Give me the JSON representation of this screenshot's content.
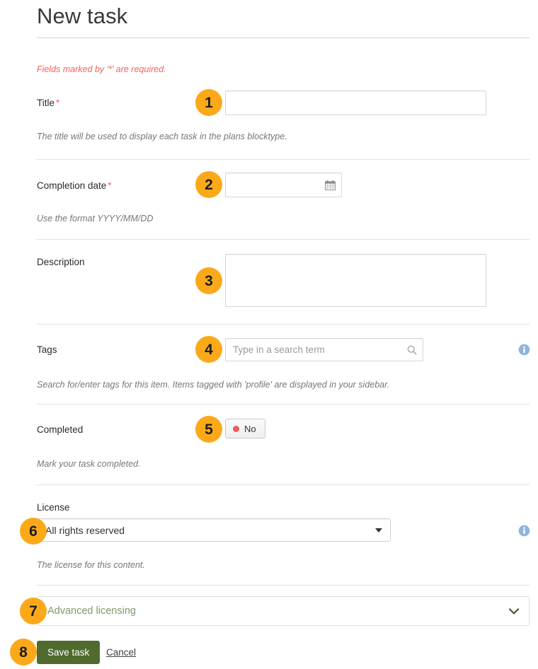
{
  "page": {
    "title": "New task",
    "required_note": "Fields marked by '*' are required."
  },
  "fields": {
    "title": {
      "label": "Title",
      "required_mark": "*",
      "value": "",
      "help": "The title will be used to display each task in the plans blocktype."
    },
    "completion_date": {
      "label": "Completion date",
      "required_mark": "*",
      "value": "",
      "help": "Use the format YYYY/MM/DD",
      "icon": "calendar-icon"
    },
    "description": {
      "label": "Description",
      "value": ""
    },
    "tags": {
      "label": "Tags",
      "value": "",
      "placeholder": "Type in a search term",
      "help": "Search for/enter tags for this item. Items tagged with 'profile' are displayed in your sidebar.",
      "icon": "search-icon",
      "info_icon": "info-icon"
    },
    "completed": {
      "label": "Completed",
      "toggle_value": "No",
      "help": "Mark your task completed.",
      "dot_color": "#f05b5b"
    },
    "license": {
      "label": "License",
      "selected": "All rights reserved",
      "options": [
        "All rights reserved"
      ],
      "help": "The license for this content.",
      "info_icon": "info-icon"
    },
    "advanced_licensing": {
      "label": "Advanced licensing",
      "icon": "chevron-down-icon"
    }
  },
  "actions": {
    "save_label": "Save task",
    "cancel_label": "Cancel"
  },
  "badges": [
    "1",
    "2",
    "3",
    "4",
    "5",
    "6",
    "7",
    "8"
  ],
  "colors": {
    "badge": "#fba919",
    "required": "#f4615f",
    "save_button": "#4f6b2e",
    "info": "#8cb4de",
    "toggle_dot": "#f05b5b"
  }
}
